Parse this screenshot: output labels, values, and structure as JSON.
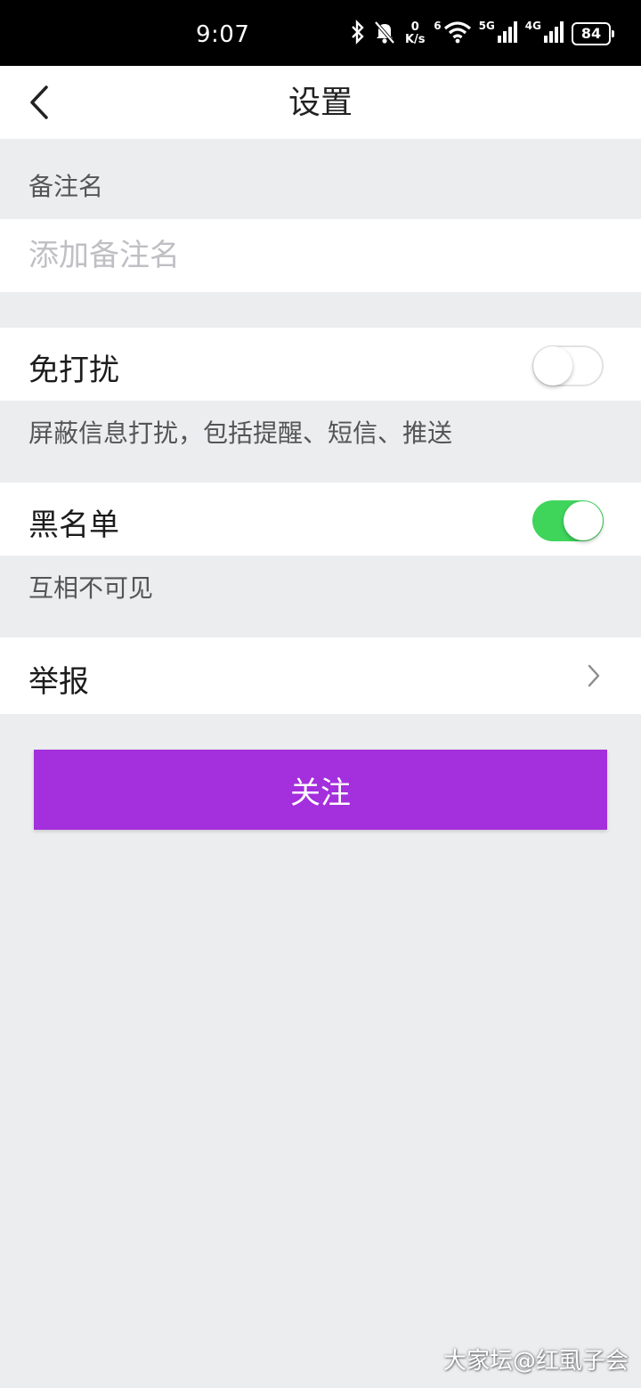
{
  "status_bar": {
    "time": "9:07",
    "net_speed_value": "0",
    "net_speed_unit": "K/s",
    "wifi_label": "6",
    "signal1_label": "5G",
    "signal2_label": "4G",
    "battery": "84"
  },
  "header": {
    "title": "设置"
  },
  "remark": {
    "label": "备注名",
    "placeholder": "添加备注名",
    "value": ""
  },
  "dnd": {
    "label": "免打扰",
    "enabled": false,
    "description": "屏蔽信息打扰，包括提醒、短信、推送"
  },
  "blacklist": {
    "label": "黑名单",
    "enabled": true,
    "description": "互相不可见"
  },
  "report": {
    "label": "举报"
  },
  "follow_button": {
    "label": "关注"
  },
  "watermark": "大家坛@红虱子会",
  "colors": {
    "accent_button": "#a42fdd",
    "toggle_on": "#3fd55b",
    "background": "#ecedef"
  }
}
